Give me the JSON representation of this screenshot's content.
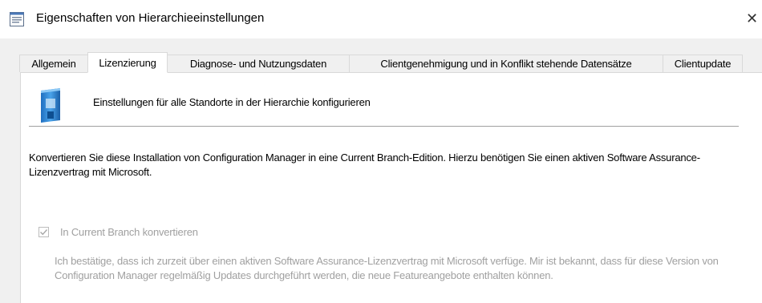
{
  "window": {
    "title": "Eigenschaften von Hierarchieeinstellungen",
    "close_symbol": "✕",
    "icon": "properties-window-icon"
  },
  "tabs": [
    {
      "label": "Allgemein",
      "active": false
    },
    {
      "label": "Lizenzierung",
      "active": true
    },
    {
      "label": "Diagnose- und Nutzungsdaten",
      "active": false
    },
    {
      "label": "Clientgenehmigung und in Konflikt stehende Datensätze",
      "active": false
    },
    {
      "label": "Clientupdate",
      "active": false
    }
  ],
  "panel": {
    "header_icon": "hierarchy-settings-icon",
    "header_text": "Einstellungen für alle Standorte in der Hierarchie konfigurieren",
    "description": "Konvertieren Sie diese Installation von Configuration Manager in eine Current Branch-Edition. Hierzu benötigen Sie einen aktiven Software Assurance-Lizenzvertrag mit Microsoft.",
    "checkbox": {
      "label": "In Current Branch konvertieren",
      "checked": true,
      "enabled": false
    },
    "note": "Ich bestätige, dass ich zurzeit über einen aktiven Software Assurance-Lizenzvertrag mit Microsoft verfüge. Mir ist bekannt, dass für diese Version von Configuration Manager regelmäßig Updates durchgeführt werden, die neue Featureangebote enthalten können."
  },
  "colors": {
    "titlebar": "#ffffff",
    "dialog_bg": "#f0f0f0",
    "panel_bg": "#ffffff",
    "disabled_text": "#a0a0a0",
    "icon_blue": "#2f86d6"
  }
}
